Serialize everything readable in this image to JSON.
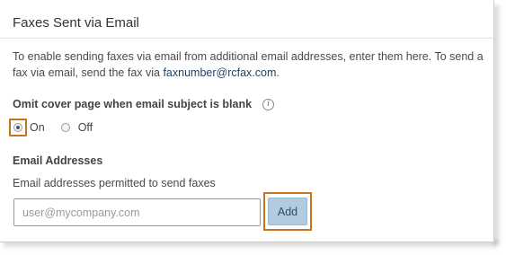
{
  "section": {
    "title": "Faxes Sent via Email",
    "description_text": "To enable sending faxes via email from additional email addresses, enter them here. To send a fax via email, send the fax via ",
    "description_link": "faxnumber@rcfax.com",
    "description_end": "."
  },
  "omit_cover": {
    "label": "Omit cover page when email subject is blank",
    "info_icon": "info-icon",
    "options": [
      {
        "label": "On",
        "selected": true
      },
      {
        "label": "Off",
        "selected": false
      }
    ]
  },
  "email_addresses": {
    "heading": "Email Addresses",
    "subtext": "Email addresses permitted to send faxes",
    "input_placeholder": "user@mycompany.com",
    "input_value": "",
    "add_label": "Add"
  },
  "colors": {
    "highlight": "#c8741d",
    "button_bg": "#b3cbdf",
    "input_border": "#6fa3cf"
  }
}
